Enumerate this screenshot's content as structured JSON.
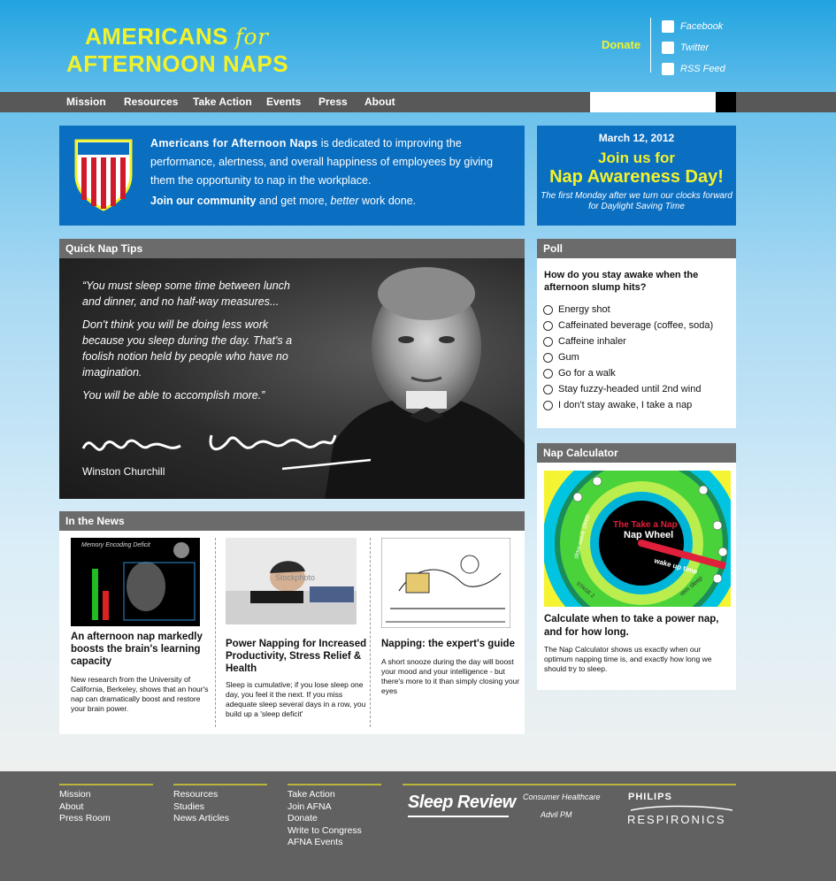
{
  "header": {
    "logo_line1": "AMERICANS",
    "logo_for": "for",
    "logo_line2": "AFTERNOON NAPS",
    "donate": "Donate",
    "social": [
      {
        "label": "Facebook",
        "icon": "facebook-icon"
      },
      {
        "label": "Twitter",
        "icon": "twitter-icon"
      },
      {
        "label": "RSS Feed",
        "icon": "rss-icon"
      }
    ]
  },
  "nav": {
    "items": [
      "Mission",
      "Resources",
      "Take Action",
      "Events",
      "Press",
      "About"
    ],
    "search_placeholder": ""
  },
  "intro": {
    "brand": "Americans for Afternoon Naps",
    "text": " is dedicated to improving the performance, alertness, and overall happiness of employees by giving them the opportunity to nap in the workplace.",
    "join_link": "Join our community",
    "join_mid": " and get more, ",
    "join_em": "better",
    "join_end": " work done."
  },
  "event": {
    "date": "March 12, 2012",
    "line1": "Join us for",
    "line2": "Nap Awareness Day!",
    "sub": "The first Monday after we turn our clocks forward for Daylight Saving Time"
  },
  "tips": {
    "header": "Quick Nap Tips",
    "quote_p1": "“You must sleep some time between lunch and dinner, and no half-way measures...",
    "quote_p2": "Don't think you will be doing less work because you sleep during the day. That's a foolish notion held by people who have no imagination.",
    "quote_p3": "You will be able to accomplish more.”",
    "author": "Winston Churchill"
  },
  "news": {
    "header": "In the News",
    "items": [
      {
        "title": "An afternoon nap markedly boosts the brain's learning capacity",
        "body": "New research from the University of California, Berkeley, shows that an hour's nap can dramatically boost and restore your brain power.",
        "image_caption": "Memory Encoding Deficit"
      },
      {
        "title": "Power Napping for Increased Productivity, Stress Relief & Health",
        "body": "Sleep is cumulative; if you lose sleep one day, you feel it the next. If you miss adequate sleep several days in a row, you build up a 'sleep deficit'",
        "image_caption": "Stockphoto"
      },
      {
        "title": "Napping: the expert's guide",
        "body": "A short snooze during the day will boost your mood and your intelligence - but there's more to it than simply closing your eyes",
        "image_caption": ""
      }
    ]
  },
  "poll": {
    "header": "Poll",
    "question": "How do you stay awake when the afternoon slump hits?",
    "options": [
      "Energy shot",
      "Caffeinated beverage (coffee, soda)",
      "Caffeine inhaler",
      "Gum",
      "Go for a walk",
      "Stay fuzzy-headed until 2nd wind",
      "I don't stay awake, I take a nap"
    ]
  },
  "calculator": {
    "header": "Nap Calculator",
    "wheel_title1": "The Take a Nap",
    "wheel_title2": "Nap Wheel",
    "wheel_wake": "wake up time",
    "wheel_slow": "slow-wave sleep",
    "wheel_rem": "rem sleep",
    "wheel_stage": "STAGE 2",
    "title": "Calculate when to take a power nap, and for how long.",
    "body": "The Nap Calculator shows us exactly when our optimum napping time is, and exactly how long we should try to sleep."
  },
  "footer": {
    "col1": [
      "Mission",
      "About",
      "Press Room"
    ],
    "col2": [
      "Resources",
      "Studies",
      "News Articles"
    ],
    "col3": [
      "Take Action",
      "Join AFNA",
      "Donate",
      "Write to Congress",
      "AFNA Events"
    ],
    "sponsors": {
      "sleep_review": "Sleep Review",
      "pfizer": "Consumer Healthcare",
      "advil": "Advil PM",
      "philips": "PHILIPS",
      "respironics": "RESPIRONICS"
    }
  },
  "colors": {
    "accent_yellow": "#f3f22a",
    "brand_blue": "#0a6ec1",
    "nav_gray": "#585858"
  }
}
